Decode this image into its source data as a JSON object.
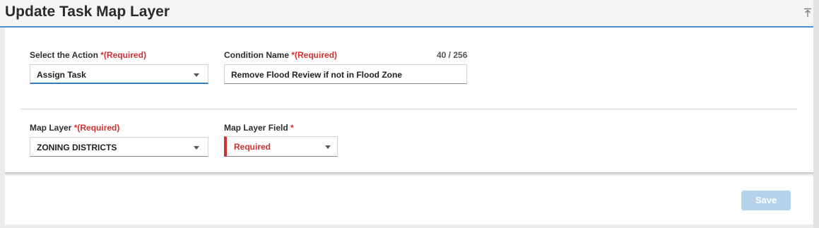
{
  "header": {
    "title": "Update Task Map Layer",
    "collapse_icon": "collapse-up-icon"
  },
  "form": {
    "action": {
      "label": "Select the Action",
      "required": "*(Required)",
      "value": "Assign Task"
    },
    "condition": {
      "label": "Condition Name",
      "required": "*(Required)",
      "counter": "40 / 256",
      "value": "Remove Flood Review if not in Flood Zone"
    },
    "map_layer": {
      "label": "Map Layer",
      "required": "*(Required)",
      "value": "ZONING DISTRICTS"
    },
    "map_layer_field": {
      "label": "Map Layer Field",
      "required": "*",
      "value": "Required"
    }
  },
  "footer": {
    "save_label": "Save"
  },
  "colors": {
    "accent": "#4a90d9",
    "required": "#d32f2f",
    "save_disabled": "#b7d3ea"
  }
}
